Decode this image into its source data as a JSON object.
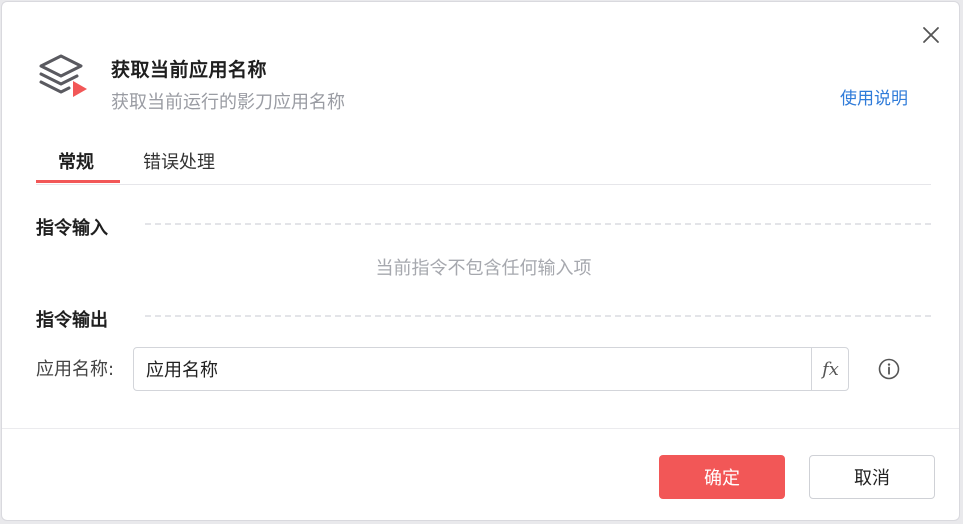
{
  "header": {
    "title": "获取当前应用名称",
    "subtitle": "获取当前运行的影刀应用名称",
    "help_link": "使用说明",
    "icon": "layers-play-icon",
    "accent_color": "#f25757"
  },
  "tabs": [
    {
      "label": "常规",
      "active": true
    },
    {
      "label": "错误处理",
      "active": false
    }
  ],
  "input_section": {
    "title": "指令输入",
    "empty_text": "当前指令不包含任何输入项"
  },
  "output_section": {
    "title": "指令输出",
    "fields": [
      {
        "label": "应用名称:",
        "value": "应用名称",
        "fx_label": "fx"
      }
    ]
  },
  "footer": {
    "confirm_label": "确定",
    "cancel_label": "取消"
  }
}
